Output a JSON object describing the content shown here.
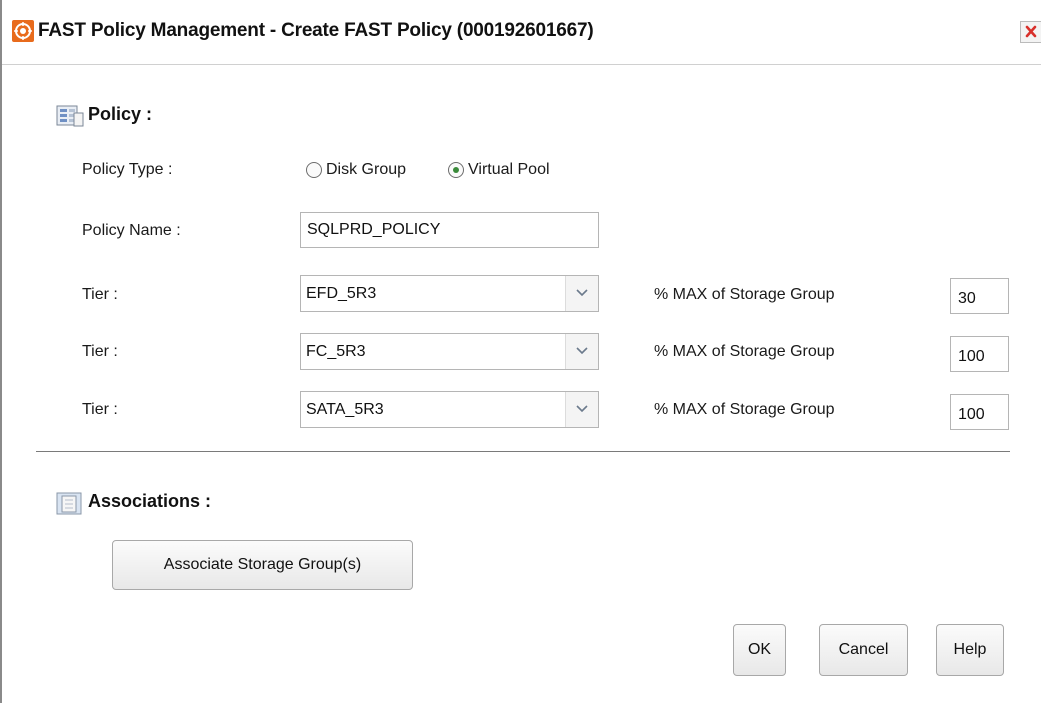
{
  "window": {
    "title": "FAST Policy Management - Create FAST Policy (000192601667)",
    "accent_color": "#e86b1c",
    "close_icon": "close-icon"
  },
  "policy": {
    "header": "Policy :",
    "header_icon": "policy-form-icon",
    "type_label": "Policy Type :",
    "type_options": [
      {
        "label": "Disk Group",
        "selected": false
      },
      {
        "label": "Virtual Pool",
        "selected": true
      }
    ],
    "name_label": "Policy Name :",
    "name_value": "SQLPRD_POLICY",
    "tiers": [
      {
        "label": "Tier :",
        "value": "EFD_5R3",
        "max_label": "% MAX of Storage Group",
        "max_value": "30"
      },
      {
        "label": "Tier :",
        "value": "FC_5R3",
        "max_label": "% MAX of Storage Group",
        "max_value": "100"
      },
      {
        "label": "Tier :",
        "value": "SATA_5R3",
        "max_label": "% MAX of Storage Group",
        "max_value": "100"
      }
    ]
  },
  "associations": {
    "header": "Associations :",
    "header_icon": "storage-group-icon",
    "associate_button": "Associate Storage Group(s)"
  },
  "footer": {
    "ok": "OK",
    "cancel": "Cancel",
    "help": "Help"
  }
}
